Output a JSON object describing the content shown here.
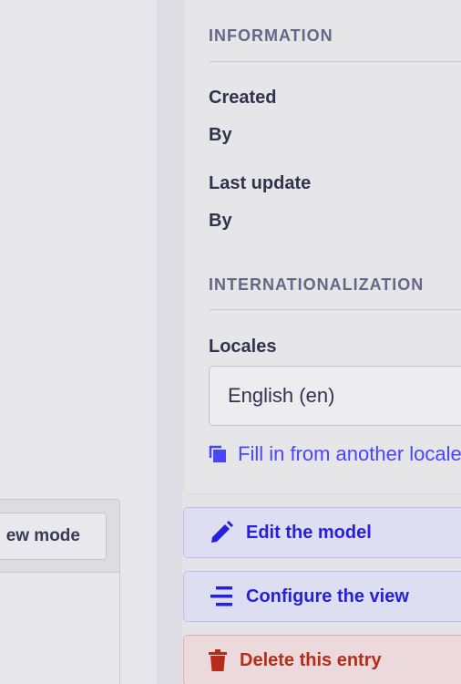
{
  "preview": {
    "button_label": "ew mode"
  },
  "information": {
    "section_title": "INFORMATION",
    "created_label": "Created",
    "created_by_label": "By",
    "updated_label": "Last update",
    "updated_by_label": "By"
  },
  "i18n": {
    "section_title": "INTERNATIONALIZATION",
    "locales_label": "Locales",
    "locale_selected": "English (en)",
    "fill_link": "Fill in from another locale"
  },
  "actions": {
    "edit_model": "Edit the model",
    "configure_view": "Configure the view",
    "delete_entry": "Delete this entry"
  },
  "colors": {
    "primary": "#4945ff",
    "primary_text": "#271fe0",
    "danger": "#b72b1a"
  }
}
